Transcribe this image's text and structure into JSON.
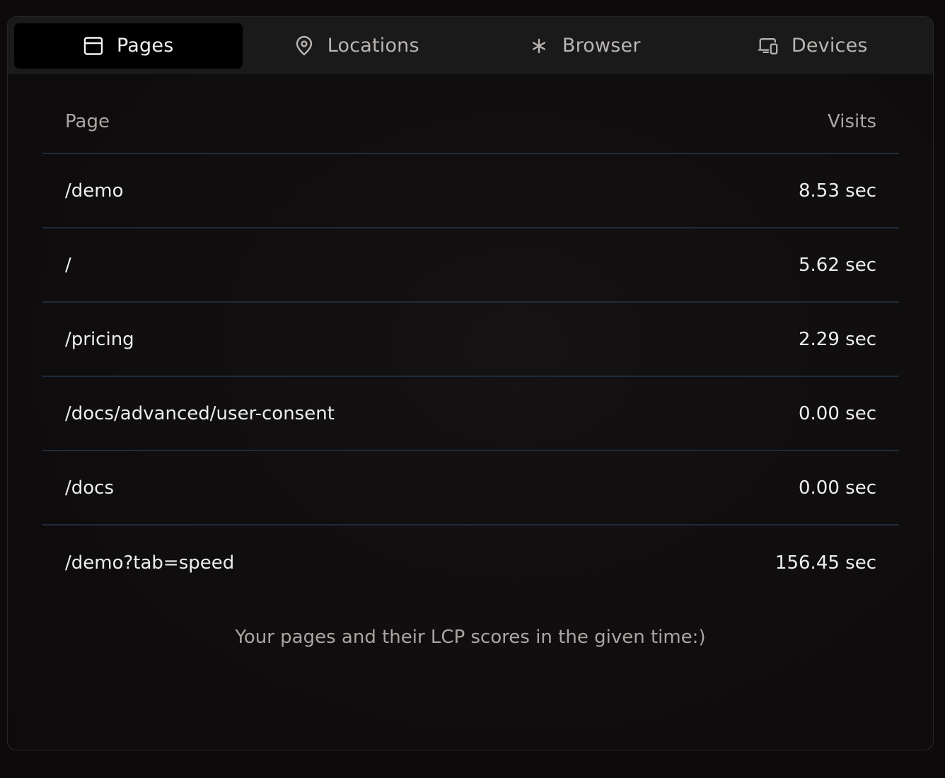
{
  "tabs": [
    {
      "label": "Pages",
      "icon": "browser-window-icon",
      "active": true
    },
    {
      "label": "Locations",
      "icon": "map-pin-icon",
      "active": false
    },
    {
      "label": "Browser",
      "icon": "asterisk-icon",
      "active": false
    },
    {
      "label": "Devices",
      "icon": "devices-icon",
      "active": false
    }
  ],
  "table": {
    "columns": [
      "Page",
      "Visits"
    ],
    "rows": [
      {
        "page": "/demo",
        "value": "8.53 sec"
      },
      {
        "page": "/",
        "value": "5.62 sec"
      },
      {
        "page": "/pricing",
        "value": "2.29 sec"
      },
      {
        "page": "/docs/advanced/user-consent",
        "value": "0.00 sec"
      },
      {
        "page": "/docs",
        "value": "0.00 sec"
      },
      {
        "page": "/demo?tab=speed",
        "value": "156.45 sec"
      }
    ]
  },
  "footer": {
    "note": "Your pages and their LCP scores in the given time:)"
  },
  "colors": {
    "background": "#0c0a0a",
    "tabbar": "#1b1a1a",
    "active_tab": "#000000",
    "divider": "#1f2a3c"
  }
}
